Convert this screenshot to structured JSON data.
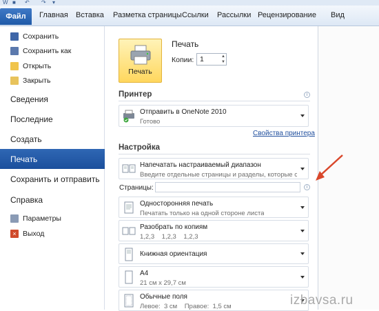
{
  "quick_access": {
    "icons": [
      "word-icon",
      "save-icon",
      "undo-icon",
      "redo-icon",
      "customize-icon"
    ]
  },
  "ribbon": {
    "file_tab": "Файл",
    "tabs": [
      "Главная",
      "Вставка",
      "Разметка страницы",
      "Ссылки",
      "Рассылки",
      "Рецензирование",
      "Вид"
    ]
  },
  "backstage": {
    "small_items": [
      {
        "label": "Сохранить",
        "icon": "save-icon"
      },
      {
        "label": "Сохранить как",
        "icon": "save-as-icon"
      },
      {
        "label": "Открыть",
        "icon": "open-folder-icon"
      },
      {
        "label": "Закрыть",
        "icon": "close-doc-icon"
      }
    ],
    "big_items": [
      "Сведения",
      "Последние",
      "Создать",
      "Печать",
      "Сохранить и отправить",
      "Справка"
    ],
    "active": "Печать",
    "bottom_items": [
      {
        "label": "Параметры",
        "icon": "options-icon"
      },
      {
        "label": "Выход",
        "icon": "exit-icon"
      }
    ]
  },
  "print": {
    "button_label": "Печать",
    "title": "Печать",
    "copies_label": "Копии:",
    "copies_value": "1"
  },
  "printer": {
    "section_title": "Принтер",
    "name": "Отправить в OneNote 2010",
    "status": "Готово",
    "properties_link": "Свойства принтера"
  },
  "settings": {
    "section_title": "Настройка",
    "range": {
      "title": "Напечатать настраиваемый диапазон",
      "subtitle": "Введите отдельные страницы и разделы, которые сл..."
    },
    "pages_label": "Страницы:",
    "pages_value": "",
    "sides": {
      "title": "Односторонняя печать",
      "subtitle": "Печатать только на одной стороне листа"
    },
    "collate": {
      "title": "Разобрать по копиям",
      "subtitle": "1,2,3    1,2,3    1,2,3"
    },
    "orientation": {
      "title": "Книжная ориентация"
    },
    "paper": {
      "title": "A4",
      "subtitle": "21 см x 29,7 см"
    },
    "margins": {
      "title": "Обычные поля",
      "subtitle": "Левое:  3 см    Правое:  1,5 см"
    }
  },
  "watermark": "izbavsa.ru",
  "colors": {
    "accent": "#2b5fae",
    "print_button": "#ffd75e",
    "arrow": "#d9472b"
  }
}
